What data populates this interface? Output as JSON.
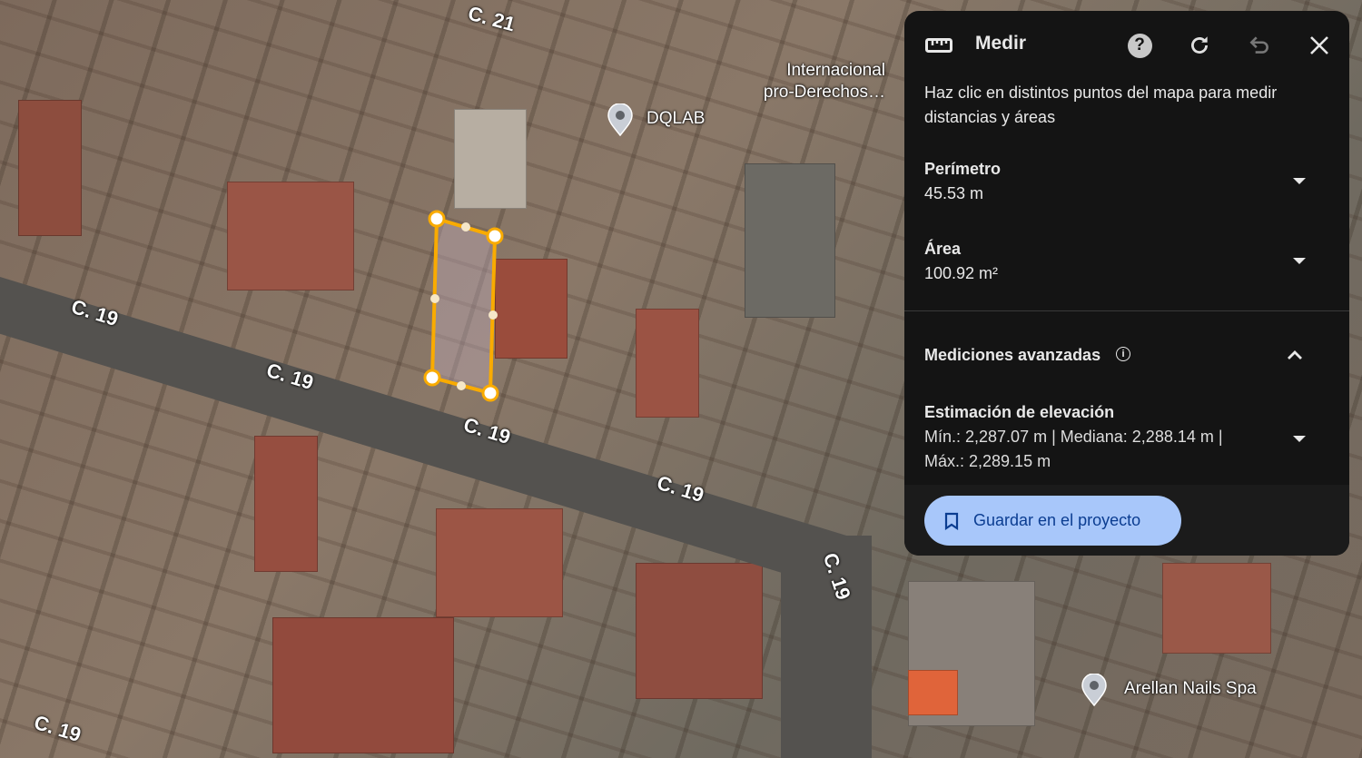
{
  "map": {
    "streets": [
      "C. 21",
      "C. 19",
      "C. 19",
      "C. 19",
      "C. 19",
      "C. 19",
      "C. 19"
    ],
    "places": [
      {
        "name": "DQLAB"
      },
      {
        "name": "Internacional pro-Derechos…"
      },
      {
        "name": "Arellan Nails Spa"
      }
    ],
    "measure_color": "#f9ab00"
  },
  "panel": {
    "title": "Medir",
    "instructions": "Haz clic en distintos puntos del mapa para medir distancias y áreas",
    "perimeter": {
      "label": "Perímetro",
      "value": "45.53 m"
    },
    "area": {
      "label": "Área",
      "value": "100.92 m²"
    },
    "advanced": {
      "label": "Mediciones avanzadas"
    },
    "elevation": {
      "label": "Estimación de elevación",
      "line1": "Mín.: 2,287.07 m | Mediana: 2,288.14 m |",
      "line2": "Máx.: 2,289.15 m"
    },
    "save_label": "Guardar en el proyecto"
  }
}
